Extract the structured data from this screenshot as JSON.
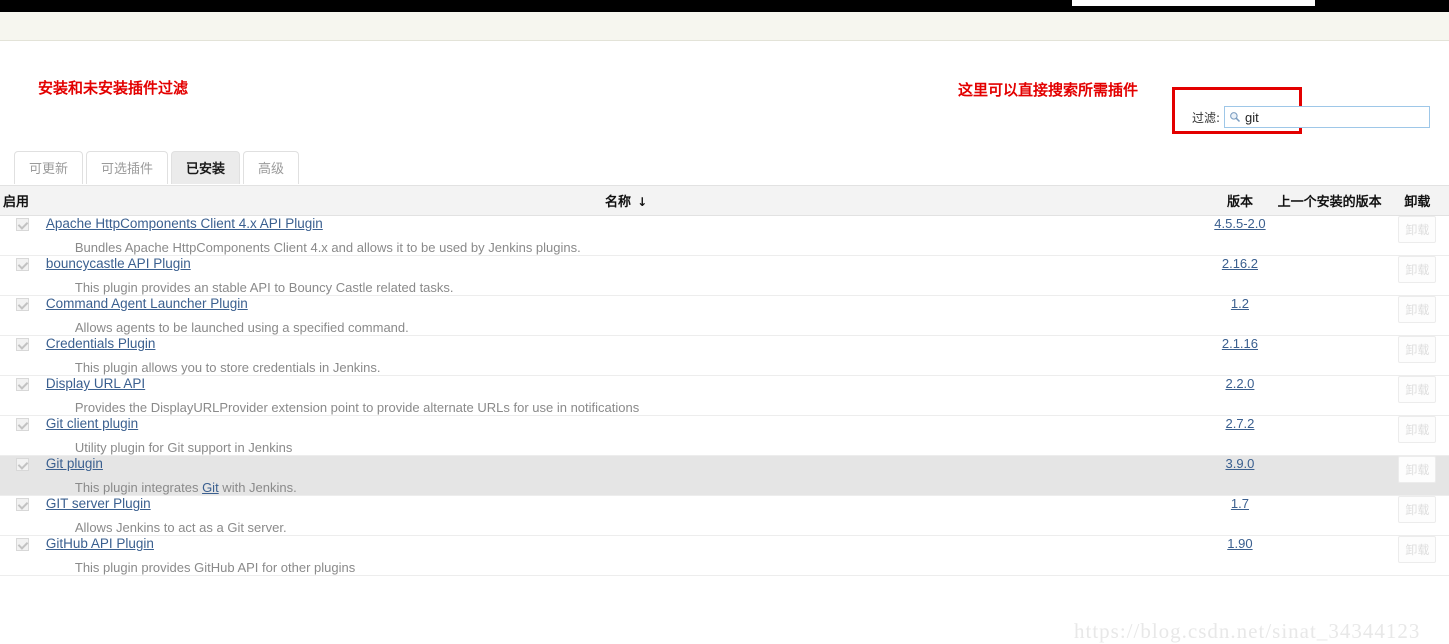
{
  "topbar": {
    "chip_label": ""
  },
  "annotations": {
    "left_note": "安装和未安装插件过滤",
    "right_note": "这里可以直接搜索所需插件"
  },
  "filter": {
    "label": "过滤:",
    "value": "git",
    "placeholder": "",
    "icon": "search-icon"
  },
  "tabs": [
    {
      "label": "可更新",
      "active": false
    },
    {
      "label": "可选插件",
      "active": false
    },
    {
      "label": "已安装",
      "active": true
    },
    {
      "label": "高级",
      "active": false
    }
  ],
  "table": {
    "headers": {
      "enable": "启用",
      "name": "名称",
      "sort_arrow": "↓",
      "version": "版本",
      "previous": "上一个安装的版本",
      "uninstall": "卸载"
    },
    "uninstall_button_label": "卸载",
    "rows": [
      {
        "name": "Apache HttpComponents Client 4.x API Plugin",
        "desc_before": "Bundles Apache HttpComponents Client 4.x and allows it to be used by Jenkins plugins.",
        "desc_link": "",
        "desc_after": "",
        "version": "4.5.5-2.0",
        "previous": "",
        "enabled": true,
        "highlight": false
      },
      {
        "name": "bouncycastle API Plugin",
        "desc_before": "This plugin provides an stable API to Bouncy Castle related tasks.",
        "desc_link": "",
        "desc_after": "",
        "version": "2.16.2",
        "previous": "",
        "enabled": true,
        "highlight": false
      },
      {
        "name": "Command Agent Launcher Plugin",
        "desc_before": "Allows agents to be launched using a specified command.",
        "desc_link": "",
        "desc_after": "",
        "version": "1.2",
        "previous": "",
        "enabled": true,
        "highlight": false
      },
      {
        "name": "Credentials Plugin",
        "desc_before": "This plugin allows you to store credentials in Jenkins.",
        "desc_link": "",
        "desc_after": "",
        "version": "2.1.16",
        "previous": "",
        "enabled": true,
        "highlight": false
      },
      {
        "name": "Display URL API",
        "desc_before": "Provides the DisplayURLProvider extension point to provide alternate URLs for use in notifications",
        "desc_link": "",
        "desc_after": "",
        "version": "2.2.0",
        "previous": "",
        "enabled": true,
        "highlight": false
      },
      {
        "name": "Git client plugin",
        "desc_before": "Utility plugin for Git support in Jenkins",
        "desc_link": "",
        "desc_after": "",
        "version": "2.7.2",
        "previous": "",
        "enabled": true,
        "highlight": false
      },
      {
        "name": "Git plugin",
        "desc_before": "This plugin integrates ",
        "desc_link": "Git",
        "desc_after": " with Jenkins.",
        "version": "3.9.0",
        "previous": "",
        "enabled": true,
        "highlight": true
      },
      {
        "name": "GIT server Plugin",
        "desc_before": "Allows Jenkins to act as a Git server.",
        "desc_link": "",
        "desc_after": "",
        "version": "1.7",
        "previous": "",
        "enabled": true,
        "highlight": false
      },
      {
        "name": "GitHub API Plugin",
        "desc_before": "This plugin provides GitHub API for other plugins",
        "desc_link": "",
        "desc_after": "",
        "version": "1.90",
        "previous": "",
        "enabled": true,
        "highlight": false
      }
    ]
  },
  "watermark": {
    "text": "https://blog.csdn.net/sinat_34344123"
  },
  "colors": {
    "annotation_red": "#e30000",
    "link_blue": "#3a5f8f",
    "row_highlight": "#e5e5e5",
    "header_bg": "#f3f3f3"
  }
}
